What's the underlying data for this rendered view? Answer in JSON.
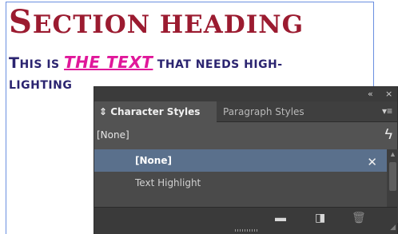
{
  "document": {
    "heading_first": "S",
    "heading_rest": "ECTION HEADING",
    "para_t": "T",
    "para_1": "HIS IS ",
    "para_highlight": "THE TEXT",
    "para_2": " THAT NEEDS HIGH-",
    "para_line2": "LIGHTING"
  },
  "panel": {
    "collapse_icon": "«",
    "close_icon": "×",
    "tabs": [
      {
        "label": "Character Styles",
        "active": true
      },
      {
        "label": "Paragraph Styles",
        "active": false
      }
    ],
    "tab_menu_icon": "▾≡",
    "current_style": "[None]",
    "items": [
      {
        "label": "[None]",
        "selected": true
      },
      {
        "label": "Text Highlight",
        "selected": false
      }
    ],
    "footer_icons": [
      "folder-icon",
      "new-style-icon",
      "delete-icon"
    ]
  },
  "colors": {
    "heading": "#9b1b30",
    "body_text": "#2b2470",
    "highlight": "#e0179a",
    "panel_bg": "#535353",
    "selected_row": "#5a708c"
  }
}
